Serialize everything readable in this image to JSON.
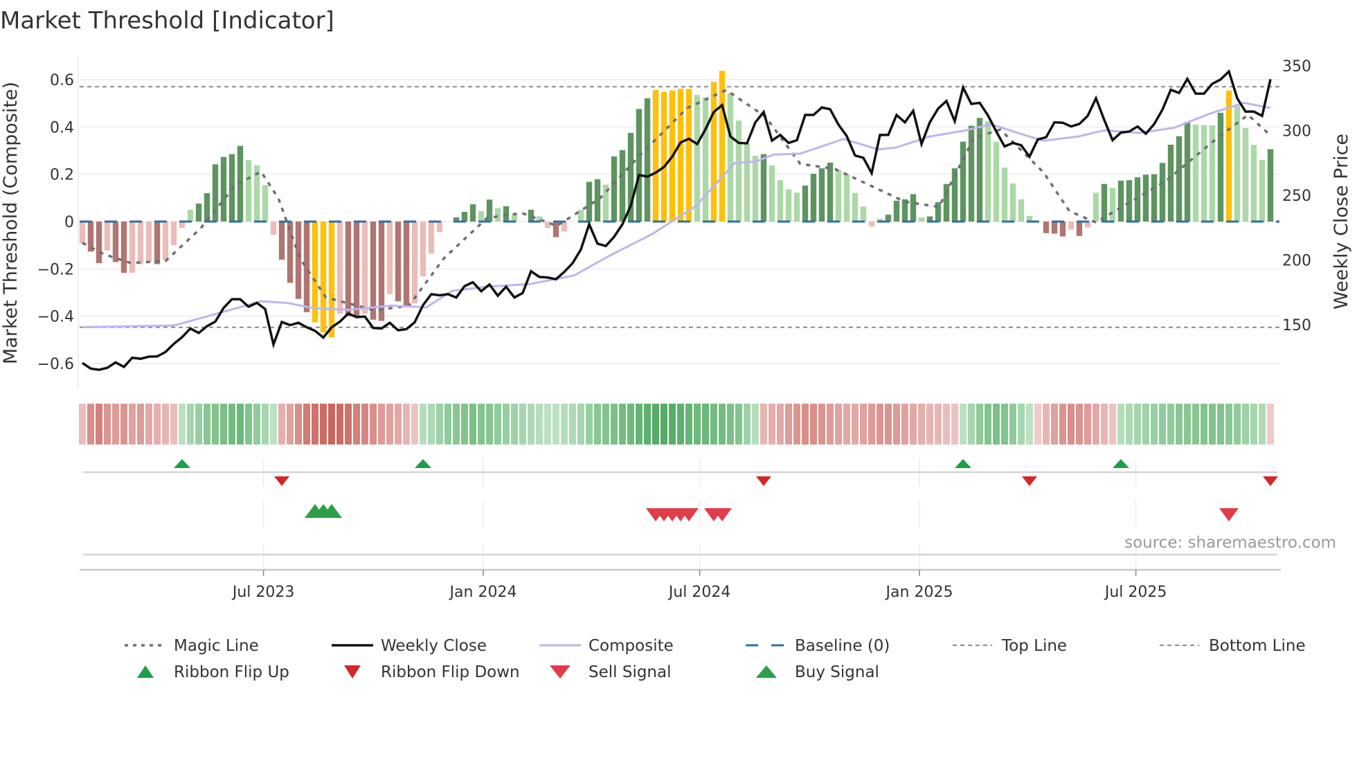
{
  "title": "Market Threshold [Indicator]",
  "source": "source: sharemaestro.com",
  "chart_data": {
    "type": "bar",
    "title": "Market Threshold [Indicator]",
    "ylabel_left": "Market Threshold (Composite)",
    "ylabel_right": "Weekly Close Price",
    "ylim_left": [
      -0.7,
      0.7
    ],
    "ylim_right": [
      100,
      375
    ],
    "left_ticks": [
      {
        "v": 0.6,
        "label": "0.6"
      },
      {
        "v": 0.4,
        "label": "0.4"
      },
      {
        "v": 0.2,
        "label": "0.2"
      },
      {
        "v": 0,
        "label": "0"
      },
      {
        "v": -0.2,
        "label": "−0.2"
      },
      {
        "v": -0.4,
        "label": "−0.4"
      },
      {
        "v": -0.6,
        "label": "−0.6"
      }
    ],
    "right_ticks": [
      {
        "v": 350,
        "label": "350"
      },
      {
        "v": 300,
        "label": "300"
      },
      {
        "v": 250,
        "label": "250"
      },
      {
        "v": 200,
        "label": "200"
      },
      {
        "v": 150,
        "label": "150"
      }
    ],
    "x_ticks": [
      {
        "week": 22.8,
        "label": "Jul 2023"
      },
      {
        "week": 49.25,
        "label": "Jan 2024"
      },
      {
        "week": 75.3,
        "label": "Jul 2024"
      },
      {
        "week": 101.75,
        "label": "Jan 2025"
      },
      {
        "week": 127.8,
        "label": "Jul 2025"
      }
    ],
    "grid": true,
    "top_line": 0.57,
    "bottom_line": -0.447,
    "baseline": 0,
    "colors": {
      "dg": "#5e9460",
      "lg": "#acd8a8",
      "dr": "#b07571",
      "lr": "#ecbcb8",
      "y": "#fdc10c",
      "close": "#111111",
      "composite": "#beb5ec",
      "magic": "#6e6e76",
      "baseline": "#2c6fa6",
      "refline": "#8a8a8a",
      "flip_up": "#1e9e48",
      "flip_down": "#d62728",
      "buy": "#2ca048",
      "sell": "#e03c4a"
    },
    "composite_bars": [
      -0.093,
      -0.127,
      -0.176,
      -0.122,
      -0.171,
      -0.217,
      -0.217,
      -0.18,
      -0.17,
      -0.18,
      -0.163,
      -0.1,
      -0.027,
      0.05,
      0.076,
      0.12,
      0.242,
      0.273,
      0.285,
      0.32,
      0.26,
      0.237,
      0.154,
      -0.056,
      -0.161,
      -0.259,
      -0.327,
      -0.383,
      -0.426,
      -0.468,
      -0.49,
      -0.39,
      -0.4,
      -0.4,
      -0.39,
      -0.415,
      -0.42,
      -0.307,
      -0.337,
      -0.356,
      -0.346,
      -0.232,
      -0.135,
      -0.044,
      0,
      0.018,
      0.041,
      0.073,
      0.044,
      0.093,
      0.057,
      0.065,
      0.03,
      0,
      0.05,
      0.022,
      -0.027,
      -0.066,
      -0.042,
      0,
      0.05,
      0.168,
      0.179,
      0.156,
      0.275,
      0.302,
      0.375,
      0.476,
      0.521,
      0.556,
      0.548,
      0.554,
      0.561,
      0.561,
      0.535,
      0.525,
      0.59,
      0.637,
      0.543,
      0.427,
      0.33,
      0.278,
      0.285,
      0.237,
      0.175,
      0.136,
      0.122,
      0.152,
      0.202,
      0.225,
      0.249,
      0.218,
      0.2,
      0.121,
      0.063,
      -0.021,
      0.012,
      0.029,
      0.088,
      0.094,
      0.116,
      0.017,
      0.022,
      0.082,
      0.159,
      0.225,
      0.338,
      0.405,
      0.438,
      0.424,
      0.337,
      0.228,
      0.161,
      0.094,
      0.024,
      0,
      -0.049,
      -0.051,
      -0.063,
      -0.034,
      -0.061,
      -0.025,
      0.122,
      0.159,
      0.143,
      0.173,
      0.175,
      0.187,
      0.198,
      0.2,
      0.248,
      0.325,
      0.361,
      0.421,
      0.41,
      0.408,
      0.407,
      0.46,
      0.554,
      0.49,
      0.395,
      0.324,
      0.261,
      0.306
    ],
    "bar_color_codes": [
      "lr",
      "dr",
      "dr",
      "lr",
      "dr",
      "dr",
      "lr",
      "lr",
      "lr",
      "dr",
      "lr",
      "lr",
      "lr",
      "lg",
      "dg",
      "dg",
      "dg",
      "dg",
      "dg",
      "dg",
      "lg",
      "lg",
      "lg",
      "lr",
      "dr",
      "dr",
      "dr",
      "dr",
      "y",
      "y",
      "y",
      "lr",
      "dr",
      "dr",
      "lr",
      "dr",
      "dr",
      "lr",
      "dr",
      "dr",
      "lr",
      "lr",
      "lr",
      "lr",
      "lg",
      "dg",
      "dg",
      "dg",
      "lg",
      "dg",
      "lg",
      "dg",
      "lg",
      "lg",
      "dg",
      "lg",
      "lr",
      "dr",
      "lr",
      "lg",
      "lg",
      "dg",
      "dg",
      "lg",
      "dg",
      "dg",
      "dg",
      "dg",
      "dg",
      "y",
      "y",
      "y",
      "y",
      "y",
      "lg",
      "lg",
      "y",
      "y",
      "lg",
      "lg",
      "lg",
      "lg",
      "dg",
      "lg",
      "lg",
      "lg",
      "lg",
      "dg",
      "dg",
      "dg",
      "dg",
      "lg",
      "lg",
      "lg",
      "lg",
      "lr",
      "lg",
      "dg",
      "dg",
      "dg",
      "dg",
      "lg",
      "dg",
      "dg",
      "dg",
      "dg",
      "dg",
      "dg",
      "dg",
      "lg",
      "lg",
      "lg",
      "lg",
      "lg",
      "lg",
      "lg",
      "dr",
      "dr",
      "dr",
      "lr",
      "dr",
      "lr",
      "lg",
      "dg",
      "lg",
      "dg",
      "dg",
      "dg",
      "dg",
      "dg",
      "dg",
      "dg",
      "dg",
      "dg",
      "lg",
      "lg",
      "lg",
      "dg",
      "y",
      "lg",
      "lg",
      "lg",
      "lg",
      "dg"
    ],
    "weekly_close": [
      120.4,
      116.0,
      115.1,
      116.6,
      120.8,
      117.3,
      124.4,
      123.6,
      125.2,
      125.4,
      128.8,
      135.1,
      140.3,
      147.0,
      143.5,
      148.8,
      152.3,
      162.9,
      169.6,
      169.6,
      163.8,
      166.8,
      162.0,
      134.6,
      152.0,
      149.6,
      151.4,
      147.9,
      145.2,
      140.0,
      147.9,
      152.3,
      158.5,
      155.8,
      156.2,
      147.4,
      147.0,
      151.4,
      145.6,
      146.5,
      151.8,
      165.0,
      173.5,
      172.6,
      173.5,
      170.9,
      179.7,
      182.7,
      175.8,
      181.0,
      172.3,
      179.2,
      170.9,
      174.4,
      191.2,
      186.8,
      186.4,
      185.0,
      190.7,
      197.4,
      208.0,
      227.5,
      212.5,
      210.7,
      217.8,
      227.5,
      241.7,
      265.5,
      264.3,
      267.3,
      271.7,
      279.7,
      290.7,
      293.5,
      289.4,
      300.9,
      314.2,
      319.5,
      295.3,
      290.3,
      290.0,
      306.2,
      314.2,
      292.1,
      296.5,
      290.3,
      292.4,
      311.9,
      311.9,
      317.7,
      316.3,
      304.5,
      295.6,
      280.6,
      278.8,
      267.0,
      296.5,
      296.5,
      311.9,
      306.2,
      315.1,
      289.4,
      306.2,
      316.8,
      322.7,
      307.1,
      333.1,
      320.4,
      321.3,
      311.5,
      299.1,
      287.6,
      290.3,
      288.5,
      279.7,
      293.0,
      294.7,
      306.2,
      305.9,
      303.0,
      305.0,
      311.2,
      324.8,
      308.0,
      292.4,
      298.3,
      299.1,
      303.0,
      297.4,
      304.8,
      316.0,
      331.4,
      328.9,
      339.8,
      328.4,
      328.4,
      336.0,
      339.3,
      345.5,
      324.8,
      314.5,
      314.5,
      311.2,
      339.5
    ],
    "composite_line": [
      [
        1,
        148
      ],
      [
        12,
        149.3
      ],
      [
        16.2,
        156.7
      ],
      [
        22.5,
        168
      ],
      [
        25.7,
        166.7
      ],
      [
        28.8,
        162.7
      ],
      [
        33,
        161.3
      ],
      [
        38.2,
        164.7
      ],
      [
        42.4,
        163.3
      ],
      [
        45.5,
        176
      ],
      [
        49.7,
        179.3
      ],
      [
        54.9,
        181.3
      ],
      [
        60.2,
        188
      ],
      [
        64.3,
        202.7
      ],
      [
        69.6,
        220
      ],
      [
        74.8,
        241.3
      ],
      [
        79.5,
        274.7
      ],
      [
        82.1,
        276
      ],
      [
        84.2,
        281.3
      ],
      [
        87.4,
        282
      ],
      [
        92.6,
        293.3
      ],
      [
        96.8,
        285.3
      ],
      [
        98.9,
        286.7
      ],
      [
        103,
        295.3
      ],
      [
        107.3,
        300
      ],
      [
        110.4,
        304.7
      ],
      [
        113.6,
        298
      ],
      [
        116.7,
        292
      ],
      [
        120.9,
        295.3
      ],
      [
        124,
        300
      ],
      [
        128.2,
        298
      ],
      [
        132.4,
        302
      ],
      [
        136.6,
        312.7
      ],
      [
        140.8,
        321.3
      ],
      [
        144,
        317.3
      ]
    ],
    "magic_line": [
      [
        1,
        -0.09
      ],
      [
        3.6,
        -0.138
      ],
      [
        6.8,
        -0.175
      ],
      [
        11,
        -0.167
      ],
      [
        15.2,
        -0.03
      ],
      [
        19.4,
        0.153
      ],
      [
        22.5,
        0.211
      ],
      [
        24.6,
        0.098
      ],
      [
        27.2,
        -0.156
      ],
      [
        30.3,
        -0.32
      ],
      [
        36.1,
        -0.375
      ],
      [
        40.3,
        -0.356
      ],
      [
        44.5,
        -0.156
      ],
      [
        49.7,
        0.015
      ],
      [
        53.9,
        0.036
      ],
      [
        58.1,
        -0.018
      ],
      [
        63.3,
        0.098
      ],
      [
        68.6,
        0.298
      ],
      [
        73.8,
        0.48
      ],
      [
        78.5,
        0.556
      ],
      [
        83.2,
        0.444
      ],
      [
        87.4,
        0.244
      ],
      [
        91.6,
        0.222
      ],
      [
        95.8,
        0.153
      ],
      [
        100,
        0.084
      ],
      [
        104.1,
        0.062
      ],
      [
        108.3,
        0.353
      ],
      [
        111.5,
        0.389
      ],
      [
        116.7,
        0.207
      ],
      [
        119.8,
        0.044
      ],
      [
        123,
        -0.004
      ],
      [
        126.1,
        0.062
      ],
      [
        131.4,
        0.171
      ],
      [
        137.6,
        0.353
      ],
      [
        141.3,
        0.451
      ],
      [
        144,
        0.364
      ]
    ],
    "ribbon": [
      -0.25,
      -0.6,
      -0.7,
      -0.55,
      -0.5,
      -0.55,
      -0.45,
      -0.5,
      -0.4,
      -0.35,
      -0.3,
      -0.25,
      0.2,
      0.35,
      0.45,
      0.55,
      0.6,
      0.65,
      0.7,
      0.75,
      0.6,
      0.5,
      0.35,
      0.2,
      -0.35,
      -0.45,
      -0.6,
      -0.75,
      -0.8,
      -0.85,
      -0.9,
      -0.85,
      -0.8,
      -0.7,
      -0.65,
      -0.6,
      -0.5,
      -0.45,
      -0.4,
      -0.3,
      -0.2,
      0.25,
      0.3,
      0.4,
      0.5,
      0.55,
      0.6,
      0.65,
      0.6,
      0.55,
      0.5,
      0.45,
      0.4,
      0.35,
      0.3,
      0.25,
      0.2,
      0.2,
      0.25,
      0.3,
      0.35,
      0.45,
      0.55,
      0.6,
      0.65,
      0.7,
      0.75,
      0.8,
      0.85,
      0.9,
      0.9,
      0.9,
      0.85,
      0.8,
      0.75,
      0.75,
      0.7,
      0.7,
      0.65,
      0.6,
      0.4,
      0.25,
      -0.3,
      -0.35,
      -0.4,
      -0.5,
      -0.55,
      -0.6,
      -0.6,
      -0.55,
      -0.5,
      -0.45,
      -0.4,
      -0.4,
      -0.45,
      -0.5,
      -0.55,
      -0.55,
      -0.5,
      -0.45,
      -0.4,
      -0.35,
      -0.3,
      -0.3,
      -0.25,
      -0.2,
      0.2,
      0.35,
      0.5,
      0.6,
      0.65,
      0.6,
      0.5,
      0.35,
      0.2,
      -0.15,
      -0.3,
      -0.45,
      -0.55,
      -0.6,
      -0.55,
      -0.5,
      -0.4,
      -0.3,
      -0.2,
      0.25,
      0.3,
      0.35,
      0.4,
      0.45,
      0.5,
      0.5,
      0.55,
      0.55,
      0.55,
      0.6,
      0.6,
      0.6,
      0.55,
      0.5,
      0.4,
      0.35,
      0.3,
      -0.15
    ],
    "ribbon_flip_up_weeks": [
      13,
      42,
      107,
      126
    ],
    "ribbon_flip_down_weeks": [
      25,
      83,
      115,
      144
    ],
    "buy_signal_weeks": [
      29,
      30,
      31
    ],
    "sell_signal_weeks": [
      70,
      71,
      72,
      73,
      74,
      77,
      78,
      139
    ],
    "legend": [
      {
        "label": "Magic Line",
        "type": "magic"
      },
      {
        "label": "Weekly Close",
        "type": "close"
      },
      {
        "label": "Composite",
        "type": "composite"
      },
      {
        "label": "Baseline (0)",
        "type": "baseline"
      },
      {
        "label": "Top Line",
        "type": "refline"
      },
      {
        "label": "Bottom Line",
        "type": "refline"
      },
      {
        "label": "Ribbon Flip Up",
        "type": "flip_up"
      },
      {
        "label": "Ribbon Flip Down",
        "type": "flip_down"
      },
      {
        "label": "Sell Signal",
        "type": "sell"
      },
      {
        "label": "Buy Signal",
        "type": "buy"
      }
    ],
    "legend_position": "bottom"
  }
}
